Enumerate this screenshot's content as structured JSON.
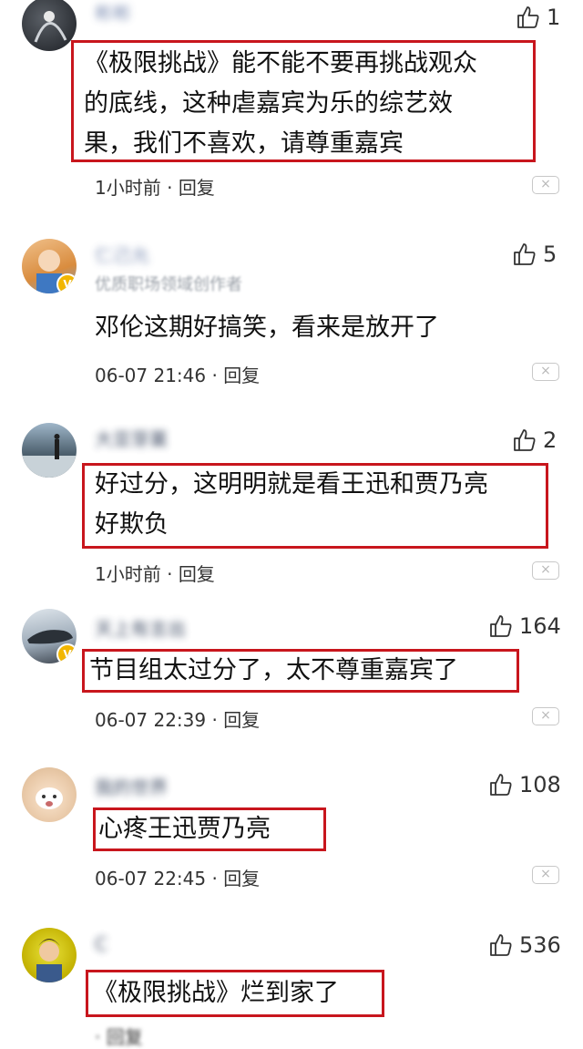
{
  "comments": [
    {
      "username": "彬彬",
      "likes": "1",
      "text_lines": [
        "《极限挑战》能不能不要再挑战观众",
        "的底线，这种虐嘉宾为乐的综艺效",
        "果，我们不喜欢，请尊重嘉宾"
      ],
      "time": "1小时前",
      "reply": "回复"
    },
    {
      "username": "仁己允",
      "subtitle": "优质职场领域创作者",
      "likes": "5",
      "text_lines": [
        "邓伦这期好搞笑，看来是放开了"
      ],
      "time": "06-07 21:46",
      "reply": "回复"
    },
    {
      "username": "大亚芽菓",
      "likes": "2",
      "text_lines": [
        "好过分，这明明就是看王迅和贾乃亮",
        "好欺负"
      ],
      "time": "1小时前",
      "reply": "回复"
    },
    {
      "username": "天上有言出",
      "likes": "164",
      "text_lines": [
        "节目组太过分了，太不尊重嘉宾了"
      ],
      "time": "06-07 22:39",
      "reply": "回复"
    },
    {
      "username": "我的世界",
      "likes": "108",
      "text_lines": [
        "心疼王迅贾乃亮"
      ],
      "time": "06-07 22:45",
      "reply": "回复"
    },
    {
      "username": "C",
      "likes": "536",
      "text_lines": [
        "《极限挑战》烂到家了"
      ],
      "time": "",
      "reply": "回复"
    }
  ],
  "separator": "·",
  "close_icon": "×",
  "colors": {
    "highlight_box": "#c8161d",
    "username": "#6a7da8",
    "badge": "#f2b600"
  }
}
